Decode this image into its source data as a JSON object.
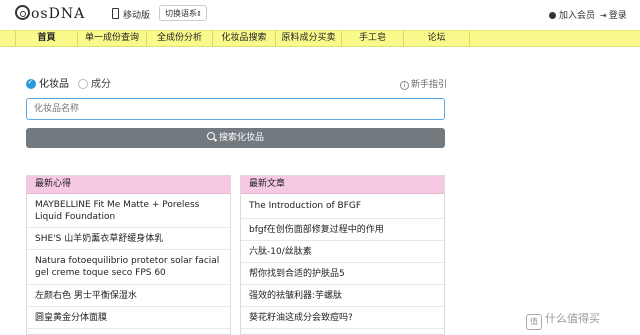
{
  "header": {
    "logo_text": "osDNA",
    "mobile_label": "移动版",
    "language_select": "切换语系",
    "join_label": "加入会员",
    "login_label": "登录"
  },
  "nav": {
    "items": [
      {
        "label": "首頁"
      },
      {
        "label": "单一成份查询"
      },
      {
        "label": "全成份分析"
      },
      {
        "label": "化妆品搜索"
      },
      {
        "label": "原料成分买卖"
      },
      {
        "label": "手工皂"
      },
      {
        "label": "论坛"
      }
    ]
  },
  "search": {
    "option_cosmetic": "化妆品",
    "option_ingredient": "成分",
    "selected": "化妆品",
    "guide_label": "新手指引",
    "input_placeholder": "化妆品名称",
    "input_value": "",
    "button_label": "搜索化妆品"
  },
  "panels": {
    "left": {
      "title": "最新心得",
      "items": [
        "MAYBELLINE Fit Me Matte + Poreless Liquid Foundation",
        "SHE'S 山羊奶薰衣草舒缓身体乳",
        "Natura fotoequilibrio protetor solar facial gel creme toque seco FPS 60",
        "左颜右色 男士平衡保湿水",
        "圆皇黄金分体面膜"
      ]
    },
    "right": {
      "title": "最新文章",
      "items": [
        "The Introduction of BFGF",
        "bfgf在创伤面部修复过程中的作用",
        "六肽-10/丝肽素",
        "帮你找到合适的护肤品5",
        "强效的祛皱利器:芋螺肽",
        "葵花籽油这成分会致痘吗?"
      ]
    }
  },
  "watermark": {
    "icon": "值",
    "text": "什么值得买"
  },
  "colors": {
    "nav_bg": "#fafa8c",
    "panel_header_bg": "#f7c8e1",
    "accent": "#2a9bd6",
    "search_button_bg": "#727a80"
  }
}
